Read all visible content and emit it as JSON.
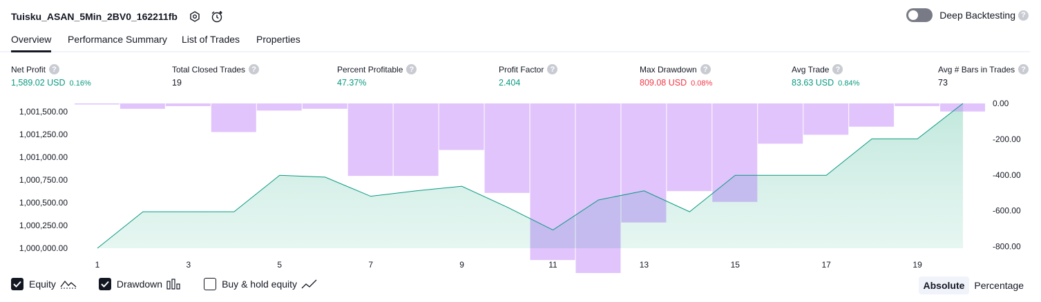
{
  "header": {
    "strategy_name": "Tuisku_ASAN_5Min_2BV0_162211fb",
    "deep_backtesting_label": "Deep Backtesting",
    "help_glyph": "?"
  },
  "tabs": [
    {
      "label": "Overview",
      "active": true
    },
    {
      "label": "Performance Summary",
      "active": false
    },
    {
      "label": "List of Trades",
      "active": false
    },
    {
      "label": "Properties",
      "active": false
    }
  ],
  "metrics": [
    {
      "label": "Net Profit",
      "value": "1,589.02 USD",
      "pct": "0.16%",
      "color": "green"
    },
    {
      "label": "Total Closed Trades",
      "value": "19",
      "pct": "",
      "color": "black"
    },
    {
      "label": "Percent Profitable",
      "value": "47.37%",
      "pct": "",
      "color": "green"
    },
    {
      "label": "Profit Factor",
      "value": "2.404",
      "pct": "",
      "color": "green"
    },
    {
      "label": "Max Drawdown",
      "value": "809.08 USD",
      "pct": "0.08%",
      "color": "red"
    },
    {
      "label": "Avg Trade",
      "value": "83.63 USD",
      "pct": "0.84%",
      "color": "green"
    },
    {
      "label": "Avg # Bars in Trades",
      "value": "73",
      "pct": "",
      "color": "black"
    }
  ],
  "legend": [
    {
      "label": "Equity",
      "checked": true,
      "icon": "equity-line-icon"
    },
    {
      "label": "Drawdown",
      "checked": true,
      "icon": "drawdown-bars-icon"
    },
    {
      "label": "Buy & hold equity",
      "checked": false,
      "icon": "buy-hold-line-icon"
    }
  ],
  "modes": [
    {
      "label": "Absolute",
      "active": true
    },
    {
      "label": "Percentage",
      "active": false
    }
  ],
  "colors": {
    "equity_line": "#089981",
    "equity_fill": "#c8ebe1",
    "drawdown_bar": "#e1c4fc",
    "overlap": "#c2b6ee",
    "positive": "#089981",
    "negative": "#f23645"
  },
  "chart_data": {
    "type": "area",
    "x": [
      1,
      2,
      3,
      4,
      5,
      6,
      7,
      8,
      9,
      10,
      11,
      12,
      13,
      14,
      15,
      16,
      17,
      18,
      19,
      20
    ],
    "x_ticks": [
      "1",
      "3",
      "5",
      "7",
      "9",
      "11",
      "13",
      "15",
      "17",
      "19"
    ],
    "series": [
      {
        "name": "Equity",
        "axis": "left",
        "style": "area",
        "values": [
          1000000,
          1000400,
          1000400,
          1000400,
          1000800,
          1000780,
          1000570,
          1000630,
          1000680,
          1000450,
          1000200,
          1000530,
          1000630,
          1000400,
          1000800,
          1000800,
          1000800,
          1001200,
          1001200,
          1001589
        ]
      },
      {
        "name": "Drawdown",
        "axis": "right",
        "style": "bar",
        "values": [
          -5,
          -30,
          -15,
          -160,
          -40,
          -30,
          -405,
          -405,
          -260,
          -500,
          -875,
          -1020,
          -665,
          -490,
          -550,
          -225,
          -175,
          -130,
          -15,
          -45
        ]
      }
    ],
    "left_axis": {
      "ticks": [
        "1,001,500.00",
        "1,001,250.00",
        "1,001,000.00",
        "1,000,750.00",
        "1,000,500.00",
        "1,000,250.00",
        "1,000,000.00"
      ],
      "range": [
        1000000,
        1001589
      ]
    },
    "right_axis": {
      "ticks": [
        "0.00",
        "-200.00",
        "-400.00",
        "-600.00",
        "-800.00"
      ],
      "range": [
        -809.08,
        0
      ]
    }
  }
}
